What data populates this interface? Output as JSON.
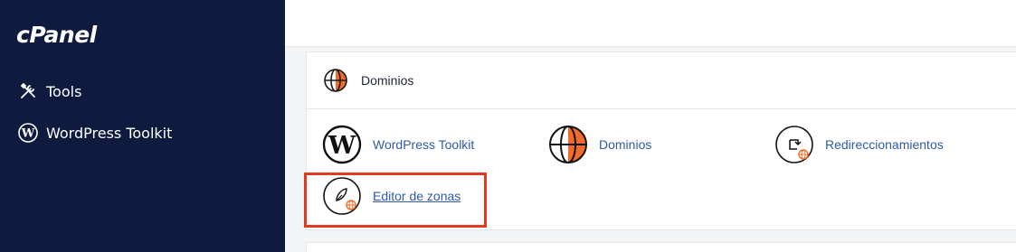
{
  "sidebar": {
    "logo": "cPanel",
    "items": [
      {
        "label": "Tools",
        "icon": "tools-icon"
      },
      {
        "label": "WordPress Toolkit",
        "icon": "wordpress-icon"
      }
    ]
  },
  "section": {
    "title": "Dominios",
    "icon": "globe-icon",
    "tools": [
      {
        "label": "WordPress Toolkit",
        "icon": "wordpress-icon"
      },
      {
        "label": "Dominios",
        "icon": "globe-icon"
      },
      {
        "label": "Redireccionamientos",
        "icon": "redirect-icon"
      },
      {
        "label": "Editor de zonas",
        "icon": "zone-editor-icon"
      }
    ]
  },
  "colors": {
    "sidebar_bg": "#0e1b3f",
    "link": "#2f5aa8",
    "accent_orange": "#f26b2a",
    "highlight": "#e23a1e"
  }
}
